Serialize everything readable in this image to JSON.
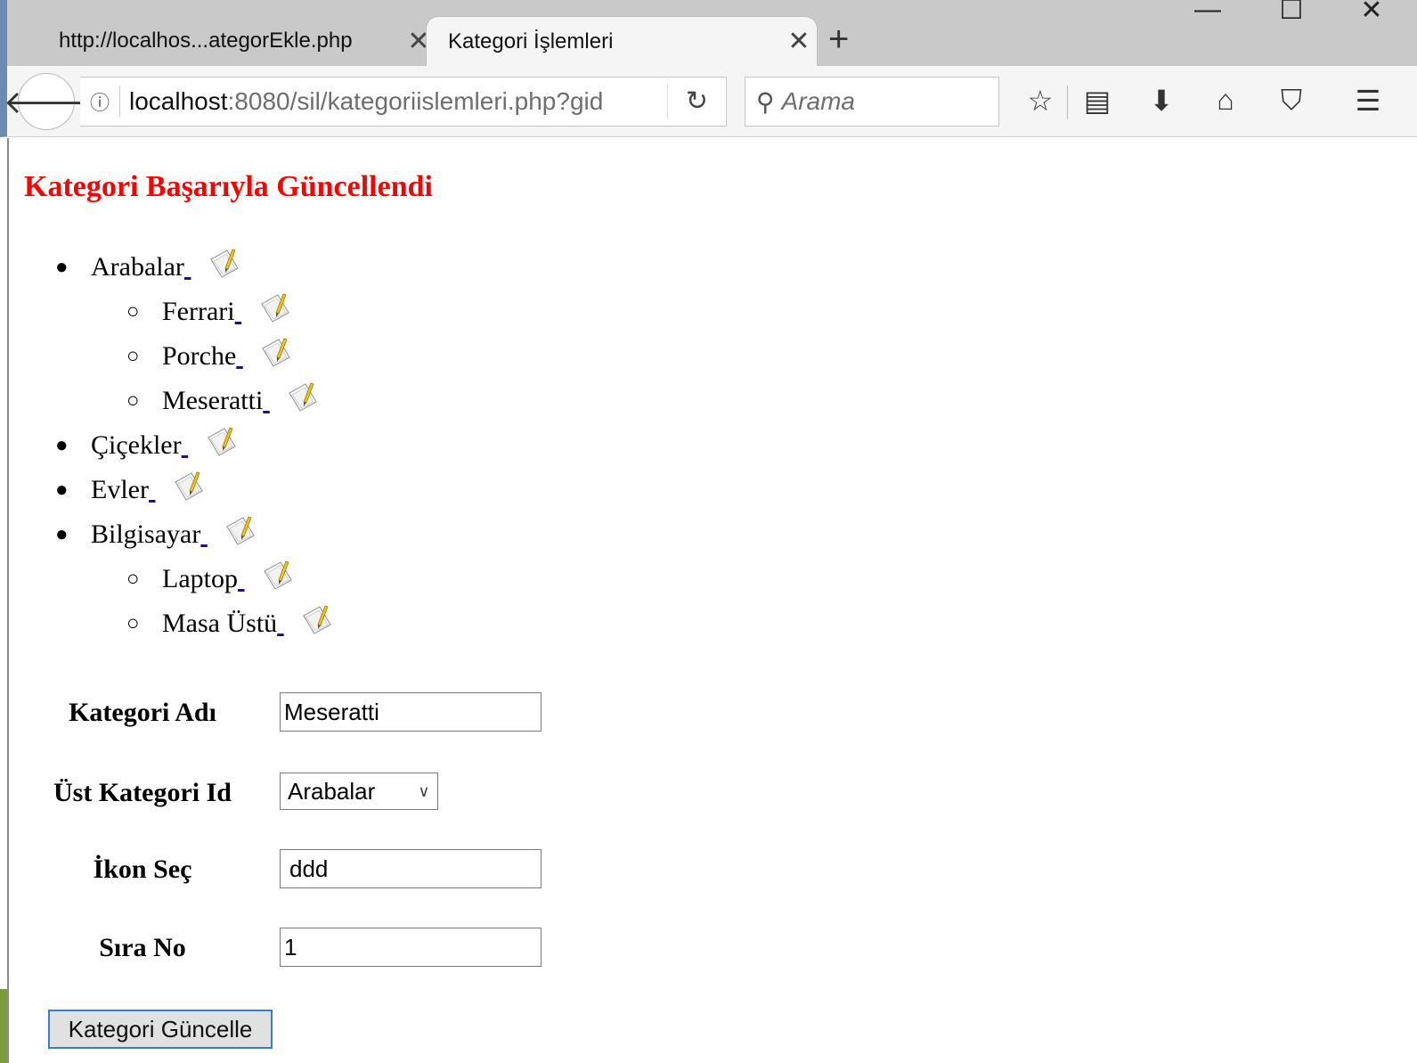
{
  "window": {
    "minimize_glyph": "—",
    "maximize_glyph": "☐",
    "close_glyph": "✕"
  },
  "tabs": [
    {
      "title": "http://localhos...ategorEkle.php",
      "close": "✕"
    },
    {
      "title": "Kategori İşlemleri",
      "close": "✕"
    }
  ],
  "new_tab": "+",
  "nav": {
    "back": "🡐",
    "info": "ⓘ",
    "url_host": "localhost",
    "url_rest": ":8080/sil/kategoriislemleri.php?gid",
    "reload": "↻",
    "search_icon": "⚲",
    "search_placeholder": "Arama",
    "toolbar": {
      "star": "☆",
      "reader": "▤",
      "download": "⬇",
      "home": "⌂",
      "pocket": "⛉",
      "menu": "☰"
    }
  },
  "page": {
    "message": "Kategori Başarıyla Güncellendi",
    "categories": [
      {
        "label": "Arabalar",
        "level": 0
      },
      {
        "label": "Ferrari",
        "level": 1
      },
      {
        "label": "Porche",
        "level": 1
      },
      {
        "label": "Meseratti",
        "level": 1
      },
      {
        "label": "Çiçekler",
        "level": 0
      },
      {
        "label": "Evler",
        "level": 0
      },
      {
        "label": "Bilgisayar",
        "level": 0
      },
      {
        "label": "Laptop",
        "level": 1
      },
      {
        "label": "Masa Üstü",
        "level": 1
      }
    ],
    "form": {
      "name_label": "Kategori Adı",
      "name_value": "Meseratti",
      "parent_label": "Üst Kategori Id",
      "parent_value": "Arabalar",
      "icon_label": "İkon Seç",
      "icon_value": "ddd",
      "order_label": "Sıra No",
      "order_value": "1",
      "submit_label": "Kategori Güncelle"
    }
  },
  "colors": {
    "message": "#ff0000",
    "link": "#1a0dab",
    "focus": "#3b7bd2"
  },
  "icons": {
    "edit": "pencil-paper-icon"
  }
}
